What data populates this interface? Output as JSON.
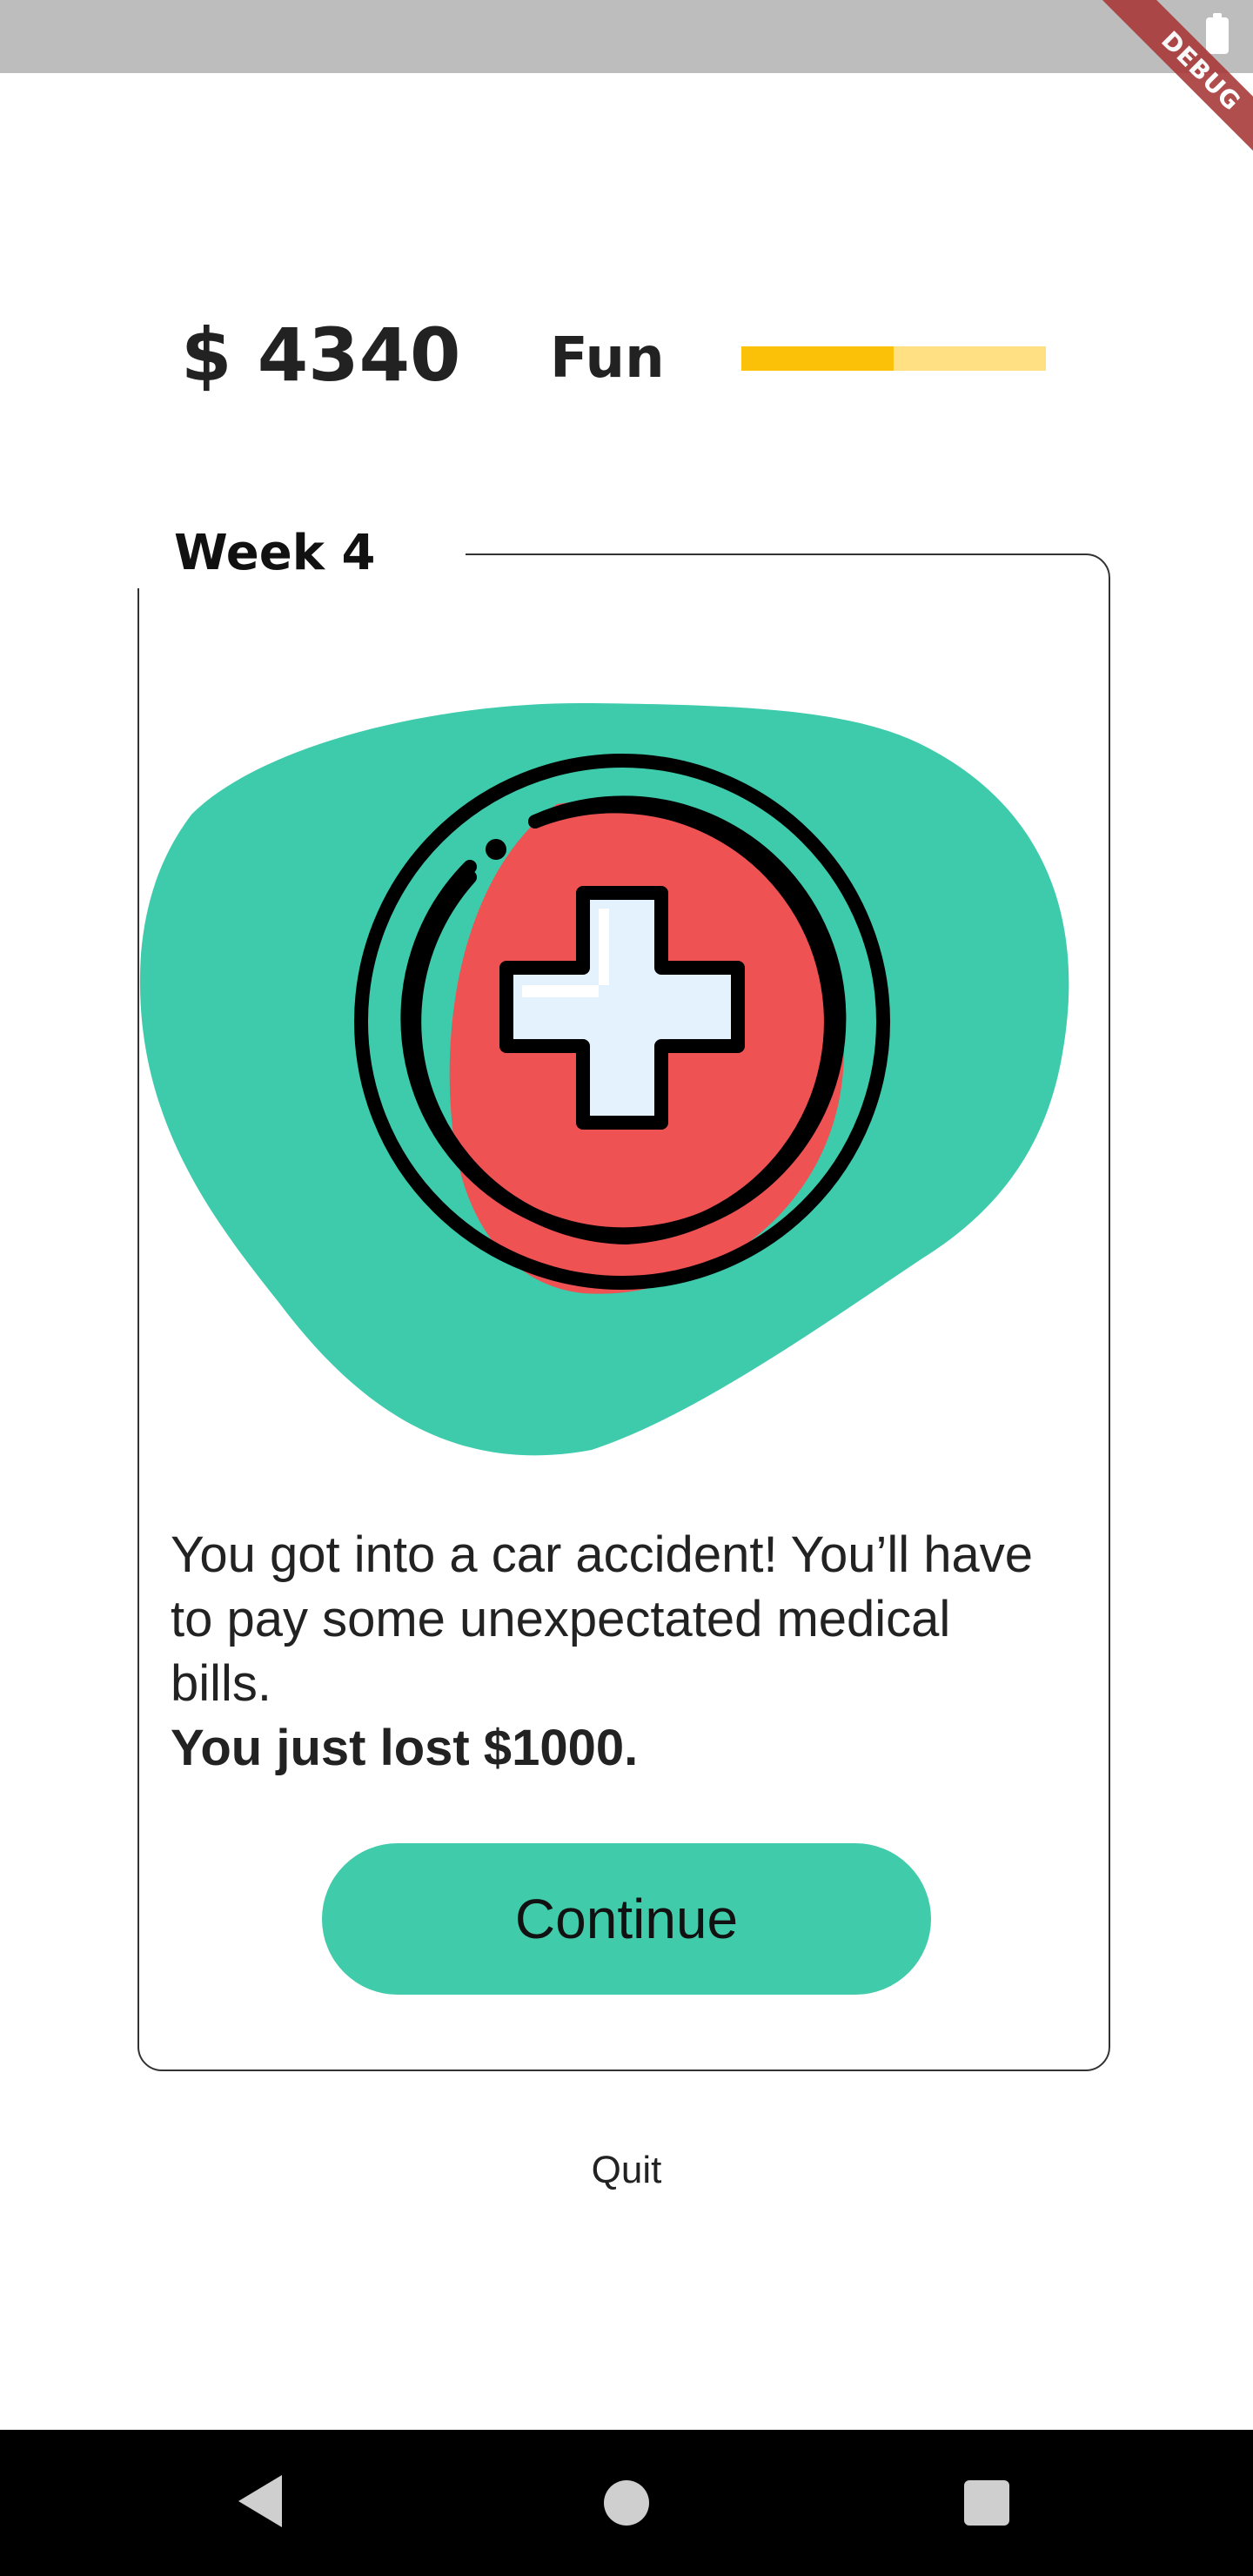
{
  "status_bar": {
    "battery_icon": "battery-icon"
  },
  "debug_banner": {
    "label": "DEBUG",
    "color": "#a83a3a"
  },
  "header": {
    "balance": "$ 4340",
    "fun_label": "Fun",
    "fun_level": 0.5,
    "fun_bar_color": "#fbc109",
    "fun_bar_track_color": "#ffe082"
  },
  "card": {
    "title": "Week 4",
    "illustration_icon": "medical-cross-icon",
    "blob_color": "#3ecbac",
    "circle_color": "#ee5253",
    "message": "You got into a car accident! You’ll have to pay some unexpectated medical bills.",
    "message_bold": "You just lost $1000.",
    "continue_label": "Continue",
    "button_color": "#40cbaa"
  },
  "footer": {
    "quit_label": "Quit"
  },
  "nav_bar": {
    "back_icon": "back-triangle-icon",
    "home_icon": "home-circle-icon",
    "recents_icon": "recents-square-icon"
  }
}
